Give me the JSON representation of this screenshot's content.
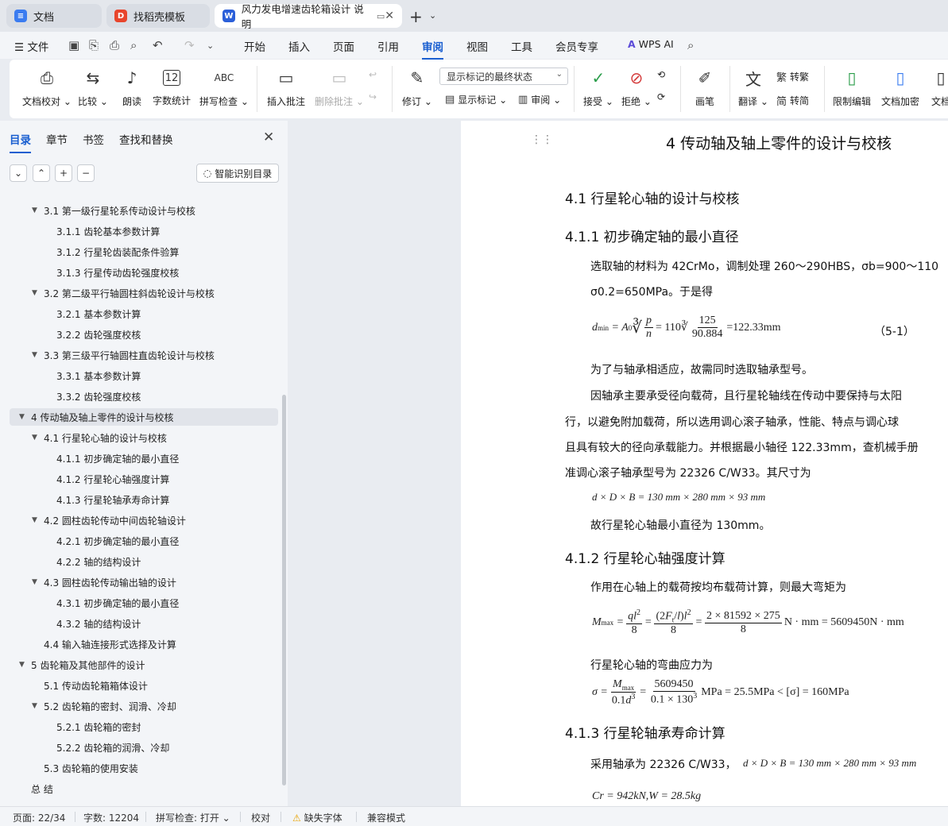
{
  "tabs": [
    {
      "label": "文档",
      "icon": "doc-icon"
    },
    {
      "label": "找稻壳模板",
      "icon": "docer-icon"
    },
    {
      "label": "风力发电增速齿轮箱设计 说明",
      "icon": "word-icon"
    }
  ],
  "menu": {
    "file": "文件",
    "items": [
      "开始",
      "插入",
      "页面",
      "引用",
      "审阅",
      "视图",
      "工具",
      "会员专享"
    ],
    "active": "审阅",
    "wps_ai": "WPS AI"
  },
  "ribbon": {
    "proofread": "文档校对",
    "compare": "比较",
    "read_aloud": "朗读",
    "word_count": "字数统计",
    "spell_check": "拼写检查",
    "insert_comment": "插入批注",
    "delete_comment": "删除批注",
    "track_changes": "修订",
    "markup_select": "显示标记的最终状态",
    "show_markup": "显示标记",
    "review": "审阅",
    "accept": "接受",
    "reject": "拒绝",
    "pen": "画笔",
    "translate": "翻译",
    "to_traditional": "转繁",
    "to_simplified": "转简",
    "restrict_edit": "限制编辑",
    "doc_encrypt": "文档加密",
    "doc_more": "文档"
  },
  "panel": {
    "tabs": [
      "目录",
      "章节",
      "书签",
      "查找和替换"
    ],
    "smart_toc": "智能识别目录",
    "toc": [
      {
        "text": "3.1 第一级行星轮系传动设计与校核",
        "level": 2,
        "tri": true
      },
      {
        "text": "3.1.1 齿轮基本参数计算",
        "level": 3
      },
      {
        "text": "3.1.2 行星轮齿装配条件验算",
        "level": 3
      },
      {
        "text": "3.1.3 行星传动齿轮强度校核",
        "level": 3
      },
      {
        "text": "3.2 第二级平行轴圆柱斜齿轮设计与校核",
        "level": 2,
        "tri": true
      },
      {
        "text": "3.2.1 基本参数计算",
        "level": 3
      },
      {
        "text": "3.2.2 齿轮强度校核",
        "level": 3
      },
      {
        "text": "3.3 第三级平行轴圆柱直齿轮设计与校核",
        "level": 2,
        "tri": true
      },
      {
        "text": "3.3.1 基本参数计算",
        "level": 3
      },
      {
        "text": "3.3.2 齿轮强度校核",
        "level": 3
      },
      {
        "text": "4 传动轴及轴上零件的设计与校核",
        "level": 1,
        "tri": true,
        "sel": true
      },
      {
        "text": "4.1 行星轮心轴的设计与校核",
        "level": 2,
        "tri": true
      },
      {
        "text": "4.1.1 初步确定轴的最小直径",
        "level": 3
      },
      {
        "text": "4.1.2 行星轮心轴强度计算",
        "level": 3
      },
      {
        "text": "4.1.3 行星轮轴承寿命计算",
        "level": 3
      },
      {
        "text": "4.2 圆柱齿轮传动中间齿轮轴设计",
        "level": 2,
        "tri": true
      },
      {
        "text": "4.2.1 初步确定轴的最小直径",
        "level": 3
      },
      {
        "text": "4.2.2 轴的结构设计",
        "level": 3
      },
      {
        "text": "4.3 圆柱齿轮传动输出轴的设计",
        "level": 2,
        "tri": true
      },
      {
        "text": "4.3.1 初步确定轴的最小直径",
        "level": 3
      },
      {
        "text": "4.3.2 轴的结构设计",
        "level": 3
      },
      {
        "text": "4.4 输入轴连接形式选择及计算",
        "level": 2
      },
      {
        "text": "5  齿轮箱及其他部件的设计",
        "level": 1,
        "tri": true
      },
      {
        "text": "5.1 传动齿轮箱箱体设计",
        "level": 2
      },
      {
        "text": "5.2 齿轮箱的密封、润滑、冷却",
        "level": 2,
        "tri": true
      },
      {
        "text": "5.2.1 齿轮箱的密封",
        "level": 3
      },
      {
        "text": "5.2.2 齿轮箱的润滑、冷却",
        "level": 3
      },
      {
        "text": "5.3 齿轮箱的使用安装",
        "level": 2
      },
      {
        "text": "总  结",
        "level": 1
      }
    ]
  },
  "doc": {
    "h1": "4 传动轴及轴上零件的设计与校核",
    "h2_1": "4.1 行星轮心轴的设计与校核",
    "h3_1": "4.1.1 初步确定轴的最小直径",
    "p1": "选取轴的材料为 42CrMo，调制处理 260～290HBS，σb=900～110",
    "p2": "σ0.2=650MPa。于是得",
    "eq1_result": "=122.33mm",
    "eq1_num": "（5-1）",
    "p3": "为了与轴承相适应，故需同时选取轴承型号。",
    "p4": "因轴承主要承受径向载荷，且行星轮轴线在传动中要保持与太阳",
    "p5": "行，以避免附加载荷，所以选用调心滚子轴承，性能、特点与调心球",
    "p6": "且具有较大的径向承载能力。并根据最小轴径 122.33mm，查机械手册",
    "p7": "准调心滚子轴承型号为 22326 C/W33。其尺寸为",
    "eq2": "d × D × B = 130 mm × 280 mm × 93 mm",
    "p8": "故行星轮心轴最小直径为 130mm。",
    "h3_2": "4.1.2 行星轮心轴强度计算",
    "p9": "作用在心轴上的载荷按均布载荷计算，则最大弯矩为",
    "eq3_result": "N · mm = 5609450N · mm",
    "p10": "行星轮心轴的弯曲应力为",
    "eq4_result": "MPa = 25.5MPa < [σ] = 160MPa",
    "h3_3": "4.1.3 行星轮轴承寿命计算",
    "p11": "采用轴承为 22326 C/W33，",
    "eq5": "d × D × B = 130 mm × 280 mm × 93 mm",
    "eq6": "Cr = 942kN,W = 28.5kg"
  },
  "status": {
    "page": "页面: 22/34",
    "words": "字数: 12204",
    "spell": "拼写检查: 打开",
    "proof": "校对",
    "font_missing": "缺失字体",
    "compat": "兼容模式"
  },
  "colors": {
    "accent": "#1a5fd0",
    "word_icon": "#2b5fd9",
    "docer_icon": "#e8452c",
    "doc_icon": "#3b7cf0"
  }
}
